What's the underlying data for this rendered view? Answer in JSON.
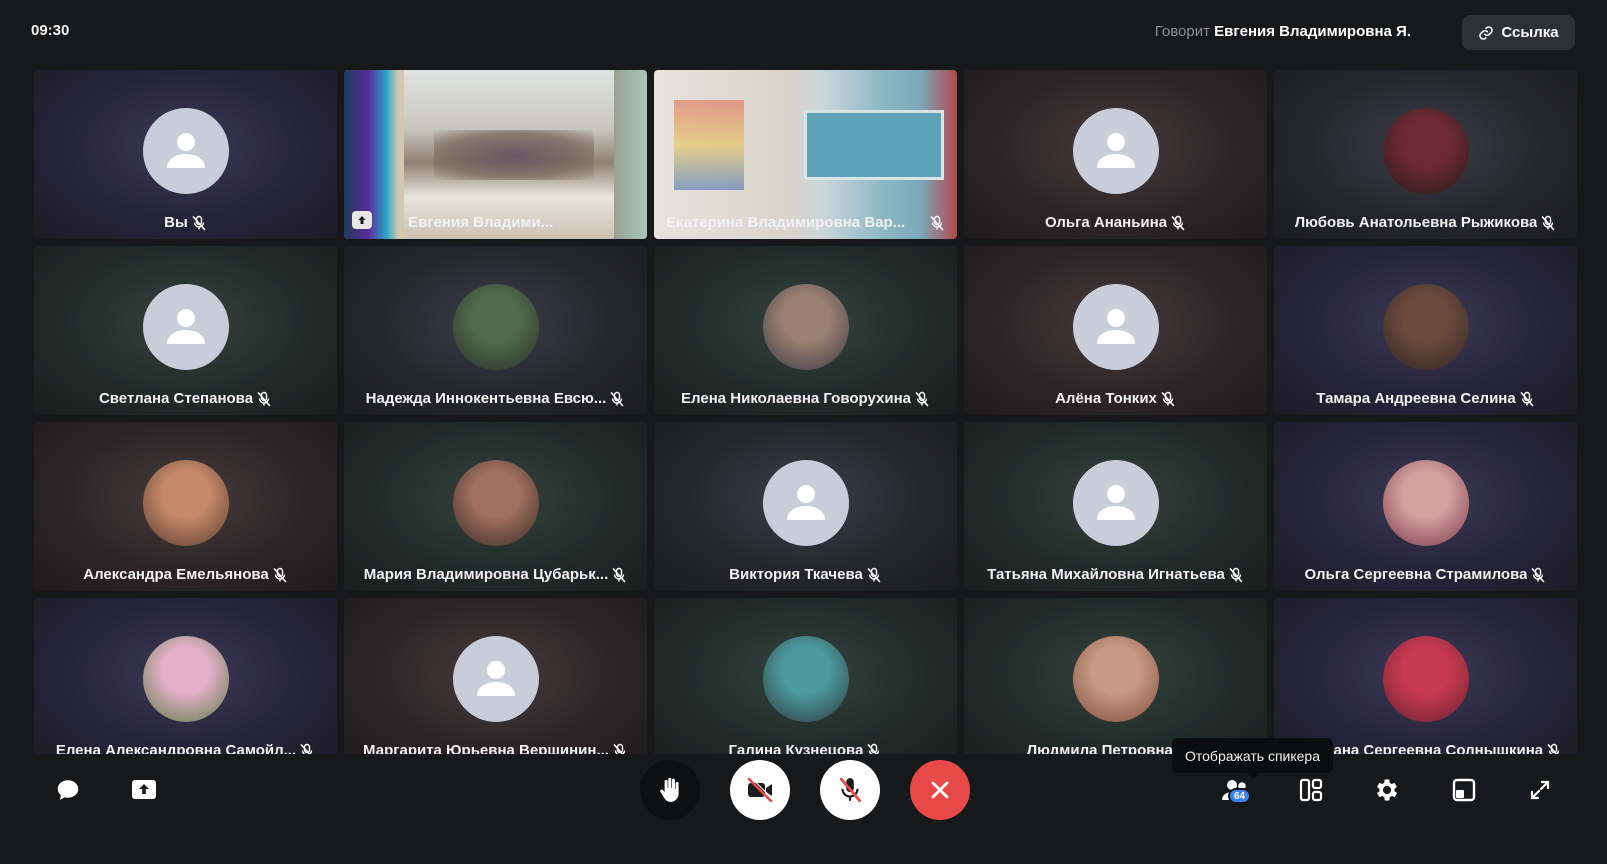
{
  "header": {
    "time": "09:30",
    "speaking_label": "Говорит",
    "speaking_name": "Евгения Владимировна Я.",
    "link_button": "Ссылка"
  },
  "participants": [
    {
      "name": "Вы",
      "avatar": "default",
      "muted": true,
      "tone": "violet"
    },
    {
      "name": "Евгения Владими...",
      "avatar": "screen-share",
      "muted": false,
      "active": true
    },
    {
      "name": "Екатерина Владимировна Вар...",
      "avatar": "camera",
      "muted": true
    },
    {
      "name": "Ольга Ананьина",
      "avatar": "default",
      "muted": true,
      "tone": "warm"
    },
    {
      "name": "Любовь Анатольевна Рыжикова",
      "avatar": "photo",
      "muted": true,
      "tone": "default"
    },
    {
      "name": "Светлана Степанова",
      "avatar": "default",
      "muted": true,
      "tone": "teal"
    },
    {
      "name": "Надежда Иннокентьевна Евсю...",
      "avatar": "photo",
      "muted": true,
      "tone": "default"
    },
    {
      "name": "Елена Николаевна Говорухина",
      "avatar": "photo",
      "muted": true,
      "tone": "teal"
    },
    {
      "name": "Алёна Тонких",
      "avatar": "default",
      "muted": true,
      "tone": "warm"
    },
    {
      "name": "Тамара Андреевна Селина",
      "avatar": "photo",
      "muted": true,
      "tone": "violet"
    },
    {
      "name": "Александра Емельянова",
      "avatar": "photo",
      "muted": true,
      "tone": "warm"
    },
    {
      "name": "Мария Владимировна Цубарьк...",
      "avatar": "photo",
      "muted": true,
      "tone": "teal"
    },
    {
      "name": "Виктория Ткачева",
      "avatar": "default",
      "muted": true,
      "tone": "default"
    },
    {
      "name": "Татьяна Михайловна Игнатьева",
      "avatar": "default",
      "muted": true,
      "tone": "teal"
    },
    {
      "name": "Ольга Сергеевна Страмилова",
      "avatar": "photo",
      "muted": true,
      "tone": "violet"
    },
    {
      "name": "Елена Александровна Самойл...",
      "avatar": "photo",
      "muted": true,
      "tone": "violet"
    },
    {
      "name": "Маргарита Юрьевна Вершинин...",
      "avatar": "default",
      "muted": true,
      "tone": "warm"
    },
    {
      "name": "Галина Кузнецова",
      "avatar": "photo",
      "muted": true,
      "tone": "teal"
    },
    {
      "name": "Людмила Петровна...",
      "avatar": "photo",
      "muted": true,
      "tone": "teal"
    },
    {
      "name": "Светлана Сергеевна Солнышкина",
      "avatar": "photo",
      "muted": true,
      "tone": "violet"
    }
  ],
  "toolbar": {
    "participants_count": "64",
    "tooltip": "Отображать спикера"
  }
}
